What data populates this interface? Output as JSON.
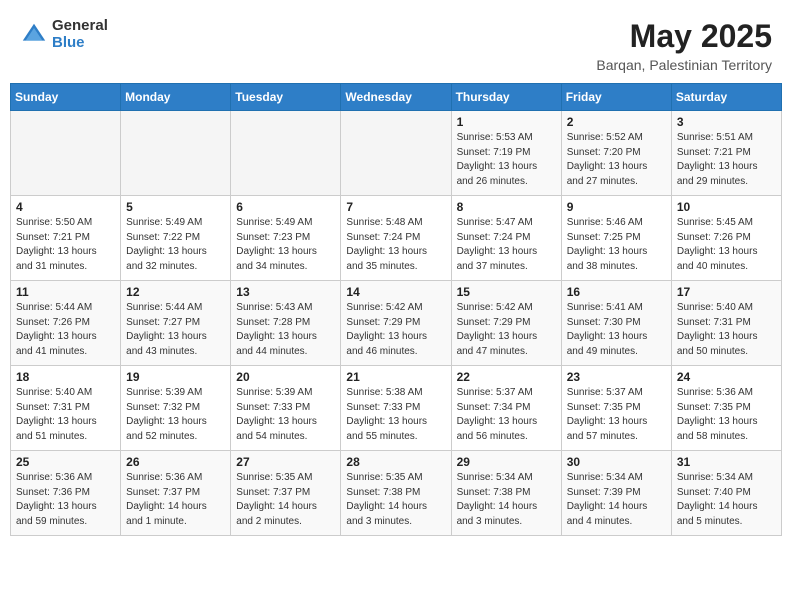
{
  "header": {
    "logo_line1": "General",
    "logo_line2": "Blue",
    "month_year": "May 2025",
    "location": "Barqan, Palestinian Territory"
  },
  "weekdays": [
    "Sunday",
    "Monday",
    "Tuesday",
    "Wednesday",
    "Thursday",
    "Friday",
    "Saturday"
  ],
  "weeks": [
    [
      {
        "day": "",
        "content": ""
      },
      {
        "day": "",
        "content": ""
      },
      {
        "day": "",
        "content": ""
      },
      {
        "day": "",
        "content": ""
      },
      {
        "day": "1",
        "content": "Sunrise: 5:53 AM\nSunset: 7:19 PM\nDaylight: 13 hours\nand 26 minutes."
      },
      {
        "day": "2",
        "content": "Sunrise: 5:52 AM\nSunset: 7:20 PM\nDaylight: 13 hours\nand 27 minutes."
      },
      {
        "day": "3",
        "content": "Sunrise: 5:51 AM\nSunset: 7:21 PM\nDaylight: 13 hours\nand 29 minutes."
      }
    ],
    [
      {
        "day": "4",
        "content": "Sunrise: 5:50 AM\nSunset: 7:21 PM\nDaylight: 13 hours\nand 31 minutes."
      },
      {
        "day": "5",
        "content": "Sunrise: 5:49 AM\nSunset: 7:22 PM\nDaylight: 13 hours\nand 32 minutes."
      },
      {
        "day": "6",
        "content": "Sunrise: 5:49 AM\nSunset: 7:23 PM\nDaylight: 13 hours\nand 34 minutes."
      },
      {
        "day": "7",
        "content": "Sunrise: 5:48 AM\nSunset: 7:24 PM\nDaylight: 13 hours\nand 35 minutes."
      },
      {
        "day": "8",
        "content": "Sunrise: 5:47 AM\nSunset: 7:24 PM\nDaylight: 13 hours\nand 37 minutes."
      },
      {
        "day": "9",
        "content": "Sunrise: 5:46 AM\nSunset: 7:25 PM\nDaylight: 13 hours\nand 38 minutes."
      },
      {
        "day": "10",
        "content": "Sunrise: 5:45 AM\nSunset: 7:26 PM\nDaylight: 13 hours\nand 40 minutes."
      }
    ],
    [
      {
        "day": "11",
        "content": "Sunrise: 5:44 AM\nSunset: 7:26 PM\nDaylight: 13 hours\nand 41 minutes."
      },
      {
        "day": "12",
        "content": "Sunrise: 5:44 AM\nSunset: 7:27 PM\nDaylight: 13 hours\nand 43 minutes."
      },
      {
        "day": "13",
        "content": "Sunrise: 5:43 AM\nSunset: 7:28 PM\nDaylight: 13 hours\nand 44 minutes."
      },
      {
        "day": "14",
        "content": "Sunrise: 5:42 AM\nSunset: 7:29 PM\nDaylight: 13 hours\nand 46 minutes."
      },
      {
        "day": "15",
        "content": "Sunrise: 5:42 AM\nSunset: 7:29 PM\nDaylight: 13 hours\nand 47 minutes."
      },
      {
        "day": "16",
        "content": "Sunrise: 5:41 AM\nSunset: 7:30 PM\nDaylight: 13 hours\nand 49 minutes."
      },
      {
        "day": "17",
        "content": "Sunrise: 5:40 AM\nSunset: 7:31 PM\nDaylight: 13 hours\nand 50 minutes."
      }
    ],
    [
      {
        "day": "18",
        "content": "Sunrise: 5:40 AM\nSunset: 7:31 PM\nDaylight: 13 hours\nand 51 minutes."
      },
      {
        "day": "19",
        "content": "Sunrise: 5:39 AM\nSunset: 7:32 PM\nDaylight: 13 hours\nand 52 minutes."
      },
      {
        "day": "20",
        "content": "Sunrise: 5:39 AM\nSunset: 7:33 PM\nDaylight: 13 hours\nand 54 minutes."
      },
      {
        "day": "21",
        "content": "Sunrise: 5:38 AM\nSunset: 7:33 PM\nDaylight: 13 hours\nand 55 minutes."
      },
      {
        "day": "22",
        "content": "Sunrise: 5:37 AM\nSunset: 7:34 PM\nDaylight: 13 hours\nand 56 minutes."
      },
      {
        "day": "23",
        "content": "Sunrise: 5:37 AM\nSunset: 7:35 PM\nDaylight: 13 hours\nand 57 minutes."
      },
      {
        "day": "24",
        "content": "Sunrise: 5:36 AM\nSunset: 7:35 PM\nDaylight: 13 hours\nand 58 minutes."
      }
    ],
    [
      {
        "day": "25",
        "content": "Sunrise: 5:36 AM\nSunset: 7:36 PM\nDaylight: 13 hours\nand 59 minutes."
      },
      {
        "day": "26",
        "content": "Sunrise: 5:36 AM\nSunset: 7:37 PM\nDaylight: 14 hours\nand 1 minute."
      },
      {
        "day": "27",
        "content": "Sunrise: 5:35 AM\nSunset: 7:37 PM\nDaylight: 14 hours\nand 2 minutes."
      },
      {
        "day": "28",
        "content": "Sunrise: 5:35 AM\nSunset: 7:38 PM\nDaylight: 14 hours\nand 3 minutes."
      },
      {
        "day": "29",
        "content": "Sunrise: 5:34 AM\nSunset: 7:38 PM\nDaylight: 14 hours\nand 3 minutes."
      },
      {
        "day": "30",
        "content": "Sunrise: 5:34 AM\nSunset: 7:39 PM\nDaylight: 14 hours\nand 4 minutes."
      },
      {
        "day": "31",
        "content": "Sunrise: 5:34 AM\nSunset: 7:40 PM\nDaylight: 14 hours\nand 5 minutes."
      }
    ]
  ]
}
